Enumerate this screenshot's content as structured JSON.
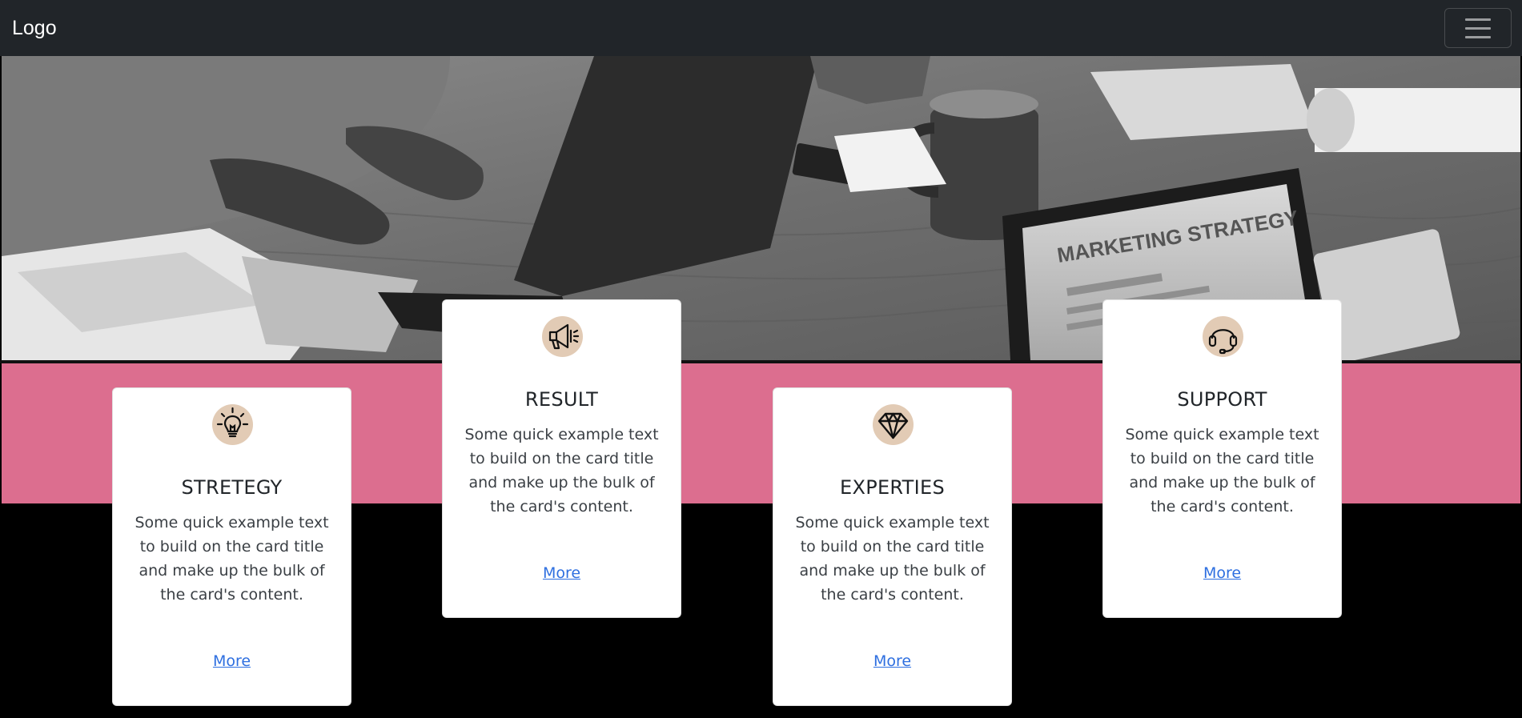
{
  "navbar": {
    "brand": "Logo",
    "menu_icon": "hamburger-menu-icon"
  },
  "hero": {
    "image": "black-and-white office desk photo with laptops, coffee mug and marketing strategy screen",
    "screen_text": "MARKETING STRATEGY"
  },
  "colors": {
    "navbar_bg": "#212529",
    "band_pink": "#dc6e8f",
    "icon_circle": "#e2cbb5",
    "link": "#2e6fe0",
    "page_bg": "#000000"
  },
  "cards": [
    {
      "icon": "lightbulb-icon",
      "title": "STRETEGY",
      "text": "Some quick example text to build on the card title and make up the bulk of the card's content.",
      "link": "More"
    },
    {
      "icon": "megaphone-icon",
      "title": "RESULT",
      "text": "Some quick example text to build on the card title and make up the bulk of the card's content.",
      "link": "More"
    },
    {
      "icon": "diamond-icon",
      "title": "EXPERTIES",
      "text": "Some quick example text to build on the card title and make up the bulk of the card's content.",
      "link": "More"
    },
    {
      "icon": "headset-icon",
      "title": "SUPPORT",
      "text": "Some quick example text to build on the card title and make up the bulk of the card's content.",
      "link": "More"
    }
  ]
}
